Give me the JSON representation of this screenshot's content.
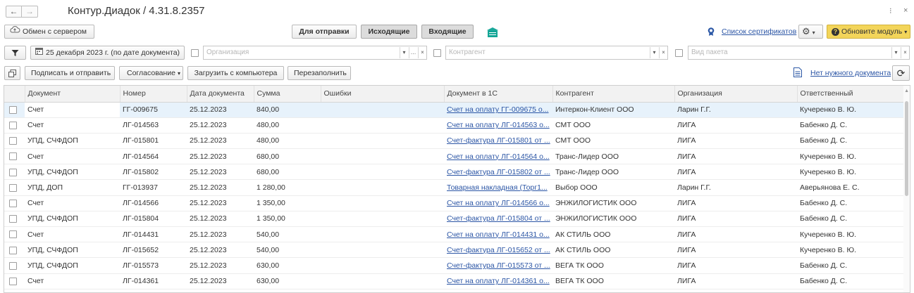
{
  "app": {
    "title": "Контур.Диадок / 4.31.8.2357",
    "back": "←",
    "forward": "→",
    "menu": "⁝",
    "close": "×"
  },
  "toolbar1": {
    "exchange": "Обмен с сервером",
    "to_send": "Для отправки",
    "outgoing": "Исходящие",
    "incoming": "Входящие",
    "certs": "Список сертификатов",
    "update": "Обновите модуль"
  },
  "filters": {
    "date": "25 декабря 2023 г. (по дате документа)",
    "org_placeholder": "Организация",
    "contr_placeholder": "Контрагент",
    "pack_placeholder": "Вид пакета"
  },
  "toolbar2": {
    "sign_send": "Подписать и отправить",
    "approval": "Согласование",
    "load": "Загрузить с компьютера",
    "refill": "Перезаполнить",
    "no_doc": "Нет нужного документа"
  },
  "columns": [
    "Документ",
    "Номер",
    "Дата документа",
    "Сумма",
    "Ошибки",
    "Документ в 1С",
    "Контрагент",
    "Организация",
    "Ответственный"
  ],
  "rows": [
    {
      "doc": "Счет",
      "num": "ГГ-009675",
      "date": "25.12.2023",
      "sum": "840,00",
      "err": "",
      "doc1c": "Счет на оплату ГГ-009675 о...",
      "contr": "Интеркон-Клиент ООО",
      "org": "Ларин Г.Г.",
      "resp": "Кучеренко В. Ю."
    },
    {
      "doc": "Счет",
      "num": "ЛГ-014563",
      "date": "25.12.2023",
      "sum": "480,00",
      "err": "",
      "doc1c": "Счет на оплату ЛГ-014563 о...",
      "contr": "СМТ ООО",
      "org": "ЛИГА",
      "resp": "Бабенко Д. С."
    },
    {
      "doc": "УПД, СЧФДОП",
      "num": "ЛГ-015801",
      "date": "25.12.2023",
      "sum": "480,00",
      "err": "",
      "doc1c": "Счет-фактура ЛГ-015801 от ...",
      "contr": "СМТ ООО",
      "org": "ЛИГА",
      "resp": "Бабенко Д. С."
    },
    {
      "doc": "Счет",
      "num": "ЛГ-014564",
      "date": "25.12.2023",
      "sum": "680,00",
      "err": "",
      "doc1c": "Счет на оплату ЛГ-014564 о...",
      "contr": "Транс-Лидер ООО",
      "org": "ЛИГА",
      "resp": "Кучеренко В. Ю."
    },
    {
      "doc": "УПД, СЧФДОП",
      "num": "ЛГ-015802",
      "date": "25.12.2023",
      "sum": "680,00",
      "err": "",
      "doc1c": "Счет-фактура ЛГ-015802 от ...",
      "contr": "Транс-Лидер ООО",
      "org": "ЛИГА",
      "resp": "Кучеренко В. Ю."
    },
    {
      "doc": "УПД, ДОП",
      "num": "ГГ-013937",
      "date": "25.12.2023",
      "sum": "1 280,00",
      "err": "",
      "doc1c": "Товарная накладная (Торг1...",
      "contr": "Выбор ООО",
      "org": "Ларин Г.Г.",
      "resp": "Аверьянова Е. С."
    },
    {
      "doc": "Счет",
      "num": "ЛГ-014566",
      "date": "25.12.2023",
      "sum": "1 350,00",
      "err": "",
      "doc1c": "Счет на оплату ЛГ-014566 о...",
      "contr": "ЭНЖИЛОГИСТИК ООО",
      "org": "ЛИГА",
      "resp": "Бабенко Д. С."
    },
    {
      "doc": "УПД, СЧФДОП",
      "num": "ЛГ-015804",
      "date": "25.12.2023",
      "sum": "1 350,00",
      "err": "",
      "doc1c": "Счет-фактура ЛГ-015804 от ...",
      "contr": "ЭНЖИЛОГИСТИК ООО",
      "org": "ЛИГА",
      "resp": "Бабенко Д. С."
    },
    {
      "doc": "Счет",
      "num": "ЛГ-014431",
      "date": "25.12.2023",
      "sum": "540,00",
      "err": "",
      "doc1c": "Счет на оплату ЛГ-014431 о...",
      "contr": "АК СТИЛЬ ООО",
      "org": "ЛИГА",
      "resp": "Кучеренко В. Ю."
    },
    {
      "doc": "УПД, СЧФДОП",
      "num": "ЛГ-015652",
      "date": "25.12.2023",
      "sum": "540,00",
      "err": "",
      "doc1c": "Счет-фактура ЛГ-015652 от ...",
      "contr": "АК СТИЛЬ ООО",
      "org": "ЛИГА",
      "resp": "Кучеренко В. Ю."
    },
    {
      "doc": "УПД, СЧФДОП",
      "num": "ЛГ-015573",
      "date": "25.12.2023",
      "sum": "630,00",
      "err": "",
      "doc1c": "Счет-фактура ЛГ-015573 от ...",
      "contr": "ВЕГА ТК ООО",
      "org": "ЛИГА",
      "resp": "Бабенко Д. С."
    },
    {
      "doc": "Счет",
      "num": "ЛГ-014361",
      "date": "25.12.2023",
      "sum": "630,00",
      "err": "",
      "doc1c": "Счет на оплату ЛГ-014361 о...",
      "contr": "ВЕГА ТК ООО",
      "org": "ЛИГА",
      "resp": "Бабенко Д. С."
    }
  ],
  "selected_row": 0
}
